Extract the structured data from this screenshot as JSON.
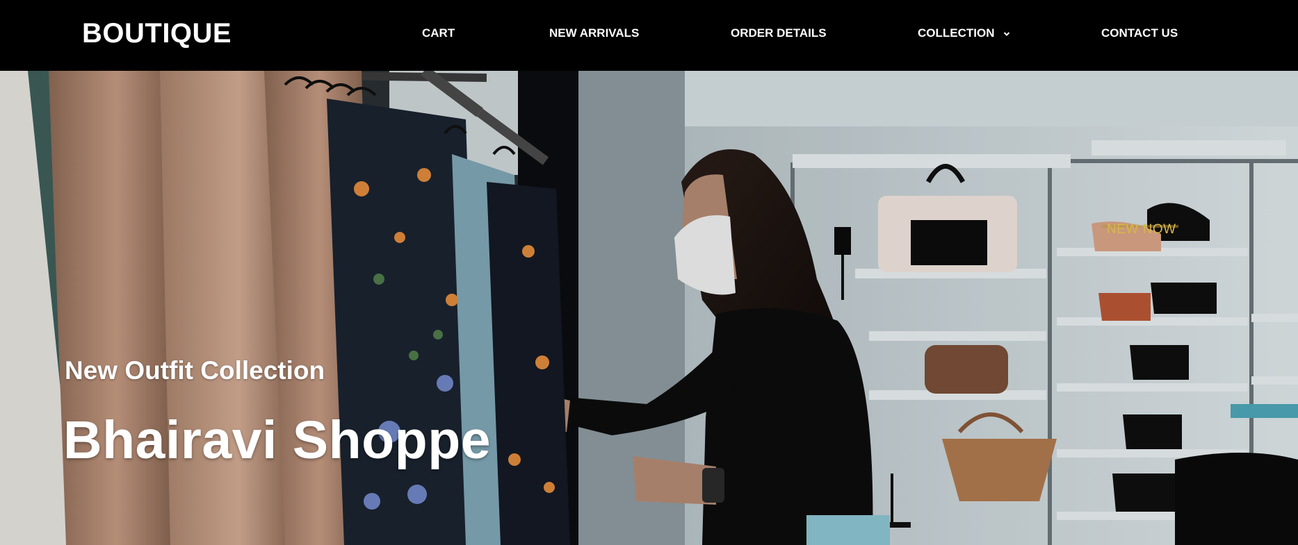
{
  "navbar": {
    "brand": "BOUTIQUE",
    "links": [
      {
        "label": "CART"
      },
      {
        "label": "NEW ARRIVALS"
      },
      {
        "label": "ORDER DETAILS"
      },
      {
        "label": "COLLECTION",
        "icon": "chevron-down-icon"
      },
      {
        "label": "CONTACT US"
      }
    ]
  },
  "hero": {
    "subtitle": "New Outfit Collection",
    "title": "Bhairavi Shoppe",
    "store_sign": "NEW NOW"
  },
  "colors": {
    "navbar_bg": "#000000",
    "text": "#ffffff",
    "sign": "#d9b64a"
  }
}
